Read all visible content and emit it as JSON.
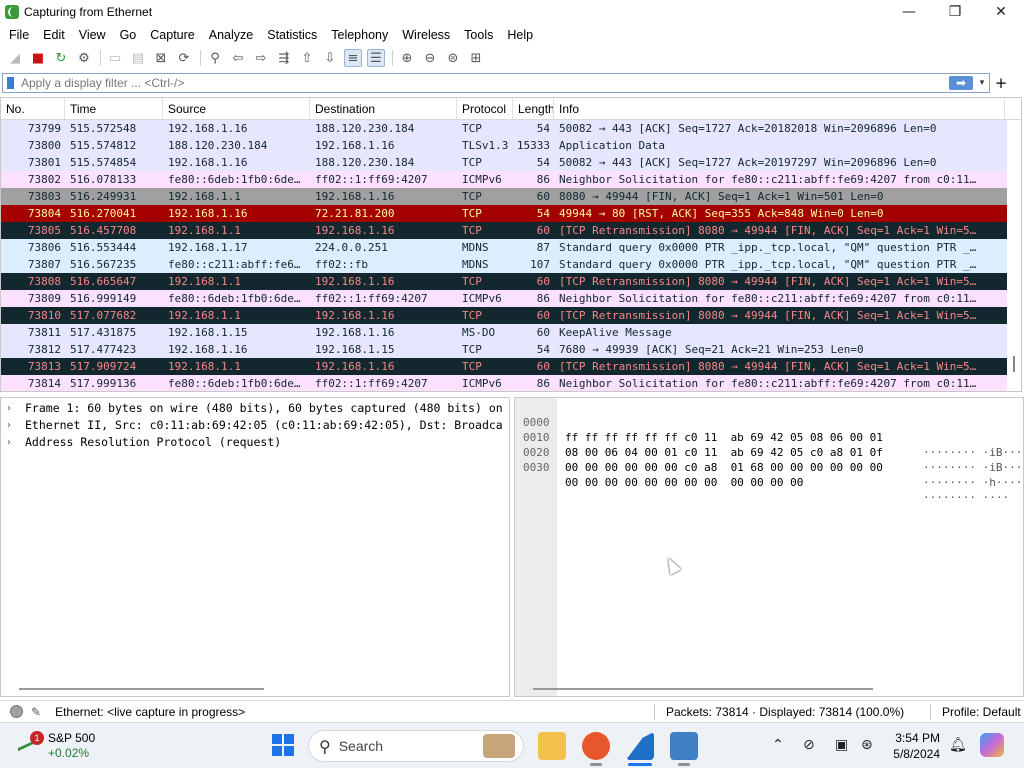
{
  "window": {
    "title": "Capturing from Ethernet",
    "controls": {
      "minimize": "—",
      "maximize": "❐",
      "close": "✕"
    }
  },
  "menu": [
    "File",
    "Edit",
    "View",
    "Go",
    "Capture",
    "Analyze",
    "Statistics",
    "Telephony",
    "Wireless",
    "Tools",
    "Help"
  ],
  "filter": {
    "placeholder": "Apply a display filter ... <Ctrl-/>",
    "apply_icon": "➡",
    "dropdown_icon": "▾",
    "add_icon": "+"
  },
  "packet_list": {
    "columns": [
      "No.",
      "Time",
      "Source",
      "Destination",
      "Protocol",
      "Length",
      "Info"
    ],
    "rows": [
      {
        "no": "73799",
        "time": "515.572548",
        "src": "192.168.1.16",
        "dst": "188.120.230.184",
        "proto": "TCP",
        "len": "54",
        "info": "50082 → 443 [ACK] Seq=1727 Ack=20182018 Win=2096896 Len=0",
        "bg": "#e7e6ff",
        "fg": "#12272e"
      },
      {
        "no": "73800",
        "time": "515.574812",
        "src": "188.120.230.184",
        "dst": "192.168.1.16",
        "proto": "TLSv1.3",
        "len": "15333",
        "info": "Application Data",
        "bg": "#e7e6ff",
        "fg": "#12272e"
      },
      {
        "no": "73801",
        "time": "515.574854",
        "src": "192.168.1.16",
        "dst": "188.120.230.184",
        "proto": "TCP",
        "len": "54",
        "info": "50082 → 443 [ACK] Seq=1727 Ack=20197297 Win=2096896 Len=0",
        "bg": "#e7e6ff",
        "fg": "#12272e"
      },
      {
        "no": "73802",
        "time": "516.078133",
        "src": "fe80::6deb:1fb0:6de…",
        "dst": "ff02::1:ff69:4207",
        "proto": "ICMPv6",
        "len": "86",
        "info": "Neighbor Solicitation for fe80::c211:abff:fe69:4207 from c0:11…",
        "bg": "#fce0ff",
        "fg": "#12272e"
      },
      {
        "no": "73803",
        "time": "516.249931",
        "src": "192.168.1.1",
        "dst": "192.168.1.16",
        "proto": "TCP",
        "len": "60",
        "info": "8080 → 49944 [FIN, ACK] Seq=1 Ack=1 Win=501 Len=0",
        "bg": "#a0a0a0",
        "fg": "#12272e"
      },
      {
        "no": "73804",
        "time": "516.270041",
        "src": "192.168.1.16",
        "dst": "72.21.81.200",
        "proto": "TCP",
        "len": "54",
        "info": "49944 → 80 [RST, ACK] Seq=355 Ack=848 Win=0 Len=0",
        "bg": "#a40000",
        "fg": "#fffc9c"
      },
      {
        "no": "73805",
        "time": "516.457708",
        "src": "192.168.1.1",
        "dst": "192.168.1.16",
        "proto": "TCP",
        "len": "60",
        "info": "[TCP Retransmission] 8080 → 49944 [FIN, ACK] Seq=1 Ack=1 Win=5…",
        "bg": "#12272e",
        "fg": "#f78787"
      },
      {
        "no": "73806",
        "time": "516.553444",
        "src": "192.168.1.17",
        "dst": "224.0.0.251",
        "proto": "MDNS",
        "len": "87",
        "info": "Standard query 0x0000 PTR _ipp._tcp.local, \"QM\" question PTR _…",
        "bg": "#daeeff",
        "fg": "#12272e"
      },
      {
        "no": "73807",
        "time": "516.567235",
        "src": "fe80::c211:abff:fe6…",
        "dst": "ff02::fb",
        "proto": "MDNS",
        "len": "107",
        "info": "Standard query 0x0000 PTR _ipp._tcp.local, \"QM\" question PTR _…",
        "bg": "#daeeff",
        "fg": "#12272e"
      },
      {
        "no": "73808",
        "time": "516.665647",
        "src": "192.168.1.1",
        "dst": "192.168.1.16",
        "proto": "TCP",
        "len": "60",
        "info": "[TCP Retransmission] 8080 → 49944 [FIN, ACK] Seq=1 Ack=1 Win=5…",
        "bg": "#12272e",
        "fg": "#f78787"
      },
      {
        "no": "73809",
        "time": "516.999149",
        "src": "fe80::6deb:1fb0:6de…",
        "dst": "ff02::1:ff69:4207",
        "proto": "ICMPv6",
        "len": "86",
        "info": "Neighbor Solicitation for fe80::c211:abff:fe69:4207 from c0:11…",
        "bg": "#fce0ff",
        "fg": "#12272e"
      },
      {
        "no": "73810",
        "time": "517.077682",
        "src": "192.168.1.1",
        "dst": "192.168.1.16",
        "proto": "TCP",
        "len": "60",
        "info": "[TCP Retransmission] 8080 → 49944 [FIN, ACK] Seq=1 Ack=1 Win=5…",
        "bg": "#12272e",
        "fg": "#f78787"
      },
      {
        "no": "73811",
        "time": "517.431875",
        "src": "192.168.1.15",
        "dst": "192.168.1.16",
        "proto": "MS-DO",
        "len": "60",
        "info": "KeepAlive Message",
        "bg": "#e7e6ff",
        "fg": "#12272e"
      },
      {
        "no": "73812",
        "time": "517.477423",
        "src": "192.168.1.16",
        "dst": "192.168.1.15",
        "proto": "TCP",
        "len": "54",
        "info": "7680 → 49939 [ACK] Seq=21 Ack=21 Win=253 Len=0",
        "bg": "#e7e6ff",
        "fg": "#12272e"
      },
      {
        "no": "73813",
        "time": "517.909724",
        "src": "192.168.1.1",
        "dst": "192.168.1.16",
        "proto": "TCP",
        "len": "60",
        "info": "[TCP Retransmission] 8080 → 49944 [FIN, ACK] Seq=1 Ack=1 Win=5…",
        "bg": "#12272e",
        "fg": "#f78787"
      },
      {
        "no": "73814",
        "time": "517.999136",
        "src": "fe80::6deb:1fb0:6de…",
        "dst": "ff02::1:ff69:4207",
        "proto": "ICMPv6",
        "len": "86",
        "info": "Neighbor Solicitation for fe80::c211:abff:fe69:4207 from c0:11…",
        "bg": "#fce0ff",
        "fg": "#12272e"
      }
    ]
  },
  "details": [
    "Frame 1: 60 bytes on wire (480 bits), 60 bytes captured (480 bits) on",
    "Ethernet II, Src: c0:11:ab:69:42:05 (c0:11:ab:69:42:05), Dst: Broadca",
    "Address Resolution Protocol (request)"
  ],
  "bytes": [
    {
      "offset": "0000",
      "hex": "ff ff ff ff ff ff c0 11  ab 69 42 05 08 06 00 01",
      "ascii": "········ ·iB·····"
    },
    {
      "offset": "0010",
      "hex": "08 00 06 04 00 01 c0 11  ab 69 42 05 c0 a8 01 0f",
      "ascii": "········ ·iB·····"
    },
    {
      "offset": "0020",
      "hex": "00 00 00 00 00 00 c0 a8  01 68 00 00 00 00 00 00",
      "ascii": "········ ·h······"
    },
    {
      "offset": "0030",
      "hex": "00 00 00 00 00 00 00 00  00 00 00 00",
      "ascii": "········ ····"
    }
  ],
  "status": {
    "interface": "Ethernet: <live capture in progress>",
    "packets": "Packets: 73814 · Displayed: 73814 (100.0%)",
    "profile": "Profile: Default"
  },
  "taskbar": {
    "stock_name": "S&P 500",
    "stock_change": "+0.02%",
    "stock_badge": "1",
    "search_label": "Search",
    "time": "3:54 PM",
    "date": "5/8/2024",
    "tray_icons": [
      "chevron-up-icon",
      "network-off-icon",
      "display-icon",
      "connection-icon",
      "bell-icon"
    ]
  }
}
